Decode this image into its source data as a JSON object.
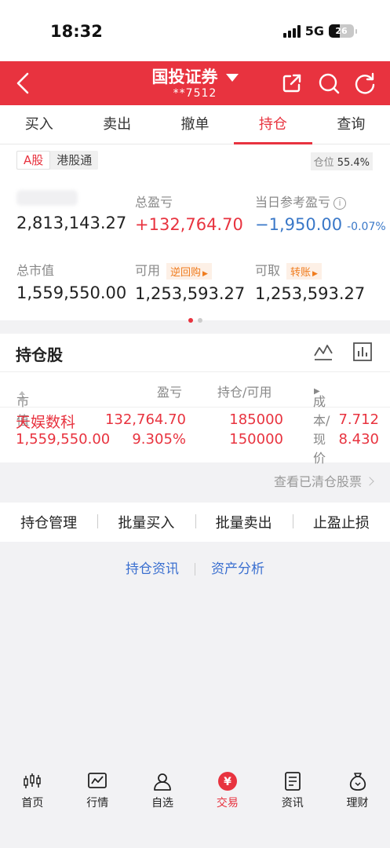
{
  "status_bar": {
    "time": "18:32",
    "network": "5G",
    "battery": "26"
  },
  "header": {
    "title": "国投证券",
    "account": "**7512"
  },
  "tabs": [
    "买入",
    "卖出",
    "撤单",
    "持仓",
    "查询"
  ],
  "active_tab": "持仓",
  "market": {
    "options": [
      "A股",
      "港股通"
    ],
    "selected": "A股"
  },
  "position_ratio": {
    "label": "仓位",
    "value": "55.4%"
  },
  "summary": {
    "total_assets_value": "2,813,143.27",
    "total_pl": {
      "label": "总盈亏",
      "value": "+132,764.70"
    },
    "daily_pl": {
      "label": "当日参考盈亏",
      "value": "−1,950.00",
      "pct": "-0.07%"
    },
    "market_value": {
      "label": "总市值",
      "value": "1,559,550.00"
    },
    "available": {
      "label": "可用",
      "tag": "逆回购",
      "value": "1,253,593.27"
    },
    "withdrawable": {
      "label": "可取",
      "tag": "转账",
      "value": "1,253,593.27"
    }
  },
  "holdings": {
    "title": "持仓股",
    "columns": {
      "market_value": "市值",
      "pl": "盈亏",
      "position": "持仓/可用",
      "cost_price": "成本/现价"
    },
    "rows": [
      {
        "name": "天娱数科",
        "market_value": "1,559,550.00",
        "pl": "132,764.70",
        "pl_pct": "9.305%",
        "position": "185000",
        "available": "150000",
        "cost": "7.712",
        "price": "8.430"
      }
    ]
  },
  "cleared_link": "查看已清仓股票",
  "actions": [
    "持仓管理",
    "批量买入",
    "批量卖出",
    "止盈止损"
  ],
  "info_links": [
    "持仓资讯",
    "资产分析"
  ],
  "bottom_nav": {
    "items": [
      "首页",
      "行情",
      "自选",
      "交易",
      "资讯",
      "理财"
    ],
    "active": "交易"
  },
  "colors": {
    "brand_red": "#e8333f",
    "blue": "#3a78c8",
    "orange": "#f07c1e"
  }
}
